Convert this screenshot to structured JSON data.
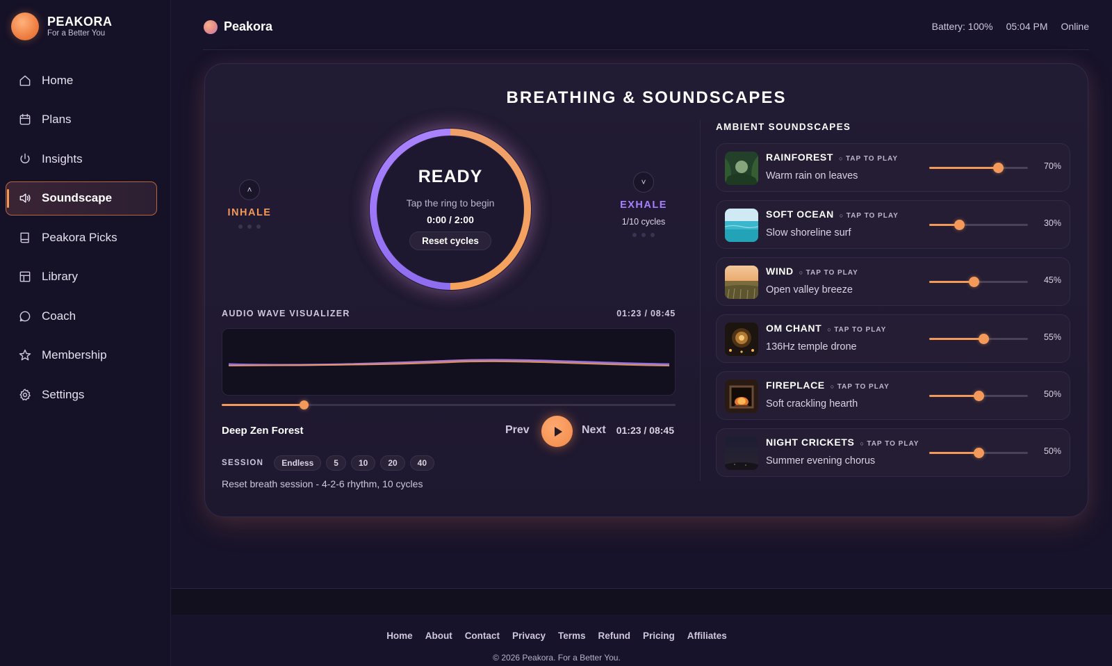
{
  "brand": {
    "name": "PEAKORA",
    "tagline": "For a Better You"
  },
  "sidebar": {
    "items": [
      {
        "label": "Home",
        "icon": "home-icon"
      },
      {
        "label": "Plans",
        "icon": "calendar-icon"
      },
      {
        "label": "Insights",
        "icon": "power-icon"
      },
      {
        "label": "Soundscape",
        "icon": "speaker-icon",
        "active": true
      },
      {
        "label": "Peakora Picks",
        "icon": "book-icon"
      },
      {
        "label": "Library",
        "icon": "grid-icon"
      },
      {
        "label": "Coach",
        "icon": "chat-icon"
      },
      {
        "label": "Membership",
        "icon": "star-icon"
      },
      {
        "label": "Settings",
        "icon": "gear-icon"
      }
    ]
  },
  "topbar": {
    "title": "Peakora",
    "battery": "Battery: 100%",
    "time": "05:04 PM",
    "connection": "Online"
  },
  "main": {
    "title": "BREATHING & SOUNDSCAPES",
    "breathing": {
      "inhale_label": "INHALE",
      "inhale_chevron": "˄",
      "exhale_label": "EXHALE",
      "exhale_chevron": "˅",
      "cycles": "1/10 cycles",
      "state": "READY",
      "hint": "Tap the ring to begin",
      "timer": "0:00 / 2:00",
      "reset_label": "Reset cycles",
      "ring_colors": {
        "inhale": "#9b7bff",
        "exhale": "#f5a463"
      }
    },
    "visualizer": {
      "label": "AUDIO WAVE VISUALIZER",
      "time": "01:23 / 08:45",
      "progress": 0.18
    },
    "player": {
      "track": "Deep Zen Forest",
      "prev_label": "Prev",
      "next_label": "Next",
      "time": "01:23 / 08:45"
    },
    "session": {
      "label": "SESSION",
      "options": [
        "Endless",
        "5",
        "10",
        "20",
        "40"
      ],
      "note": "Reset breath session - 4-2-6 rhythm, 10 cycles"
    },
    "soundscapes": {
      "title": "AMBIENT SOUNDSCAPES",
      "tap_label": "TAP TO PLAY",
      "items": [
        {
          "name": "RAINFOREST",
          "desc": "Warm rain on leaves",
          "volume": 70,
          "volume_label": "70%",
          "icon": "rainforest-thumbnail"
        },
        {
          "name": "SOFT OCEAN",
          "desc": "Slow shoreline surf",
          "volume": 30,
          "volume_label": "30%",
          "icon": "ocean-thumbnail"
        },
        {
          "name": "WIND",
          "desc": "Open valley breeze",
          "volume": 45,
          "volume_label": "45%",
          "icon": "wind-thumbnail"
        },
        {
          "name": "OM CHANT",
          "desc": "136Hz temple drone",
          "volume": 55,
          "volume_label": "55%",
          "icon": "om-chant-thumbnail"
        },
        {
          "name": "FIREPLACE",
          "desc": "Soft crackling hearth",
          "volume": 50,
          "volume_label": "50%",
          "icon": "fireplace-thumbnail"
        },
        {
          "name": "NIGHT CRICKETS",
          "desc": "Summer evening chorus",
          "volume": 50,
          "volume_label": "50%",
          "icon": "night-crickets-thumbnail"
        }
      ]
    }
  },
  "footer": {
    "links": [
      "Home",
      "About",
      "Contact",
      "Privacy",
      "Terms",
      "Refund",
      "Pricing",
      "Affiliates"
    ],
    "copyright": "© 2026 Peakora. For a Better You."
  },
  "colors": {
    "accent": "#f39a5b",
    "purple": "#9b7bff",
    "background": "#17132a"
  }
}
